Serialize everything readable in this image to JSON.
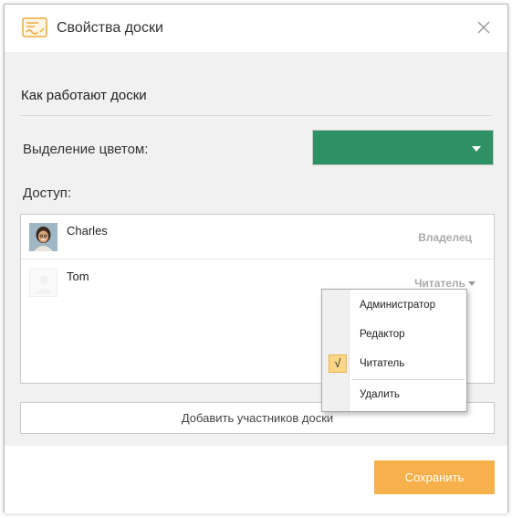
{
  "dialog": {
    "title": "Свойства доски",
    "icons": {
      "title": "board-icon",
      "close": "close-icon"
    }
  },
  "body": {
    "how_link": "Как работают доски",
    "color_label": "Выделение цветом:",
    "color_value": "#2e9163",
    "access_label": "Доступ:"
  },
  "members": [
    {
      "name": "Charles",
      "role": "Владелец",
      "avatar": "photo"
    },
    {
      "name": "Tom",
      "role": "Читатель",
      "avatar": "blank"
    }
  ],
  "role_menu": {
    "items": [
      {
        "label": "Администратор",
        "checked": false
      },
      {
        "label": "Редактор",
        "checked": false
      },
      {
        "label": "Читатель",
        "checked": true
      },
      {
        "label": "Удалить",
        "checked": false
      }
    ],
    "check_glyph": "√"
  },
  "add_members_label": "Добавить участников доски",
  "save_label": "Сохранить",
  "colors": {
    "accent_save": "#f6b04c",
    "selected_check": "#fbd685"
  }
}
